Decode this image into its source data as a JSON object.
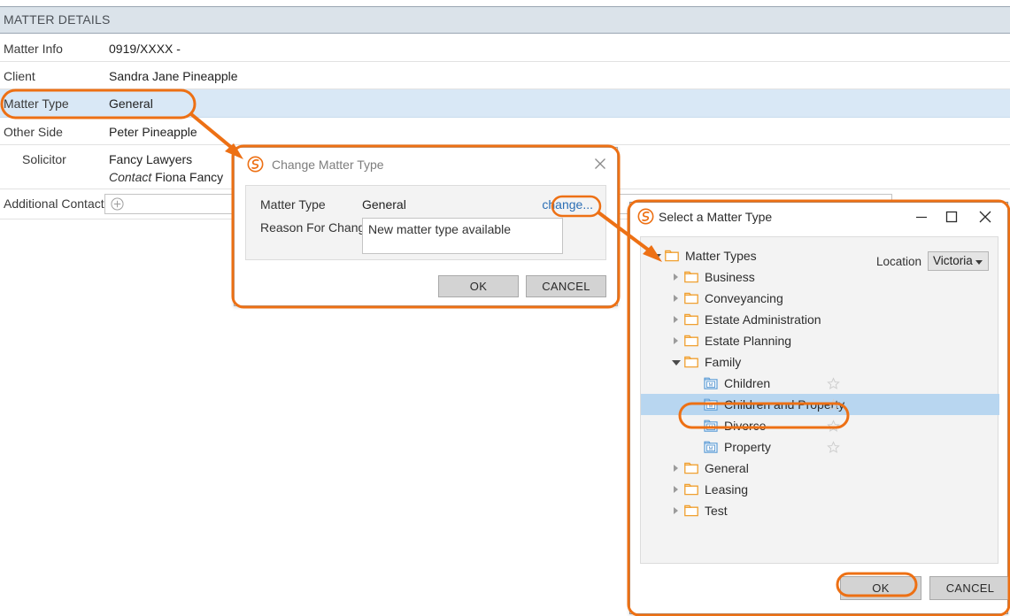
{
  "matter_details": {
    "header": "MATTER DETAILS",
    "rows": [
      {
        "label": "Matter Info",
        "value": "0919/XXXX -",
        "highlight": false
      },
      {
        "label": "Client",
        "value": "Sandra Jane Pineapple",
        "highlight": false
      },
      {
        "label": "Matter Type",
        "value": "General",
        "highlight": true
      },
      {
        "label": "Other Side",
        "value": "Peter Pineapple",
        "highlight": false
      },
      {
        "label": "Solicitor",
        "value": "Fancy Lawyers",
        "value_sub_italic": "Contact",
        "value_sub": "Fiona Fancy",
        "highlight": false
      },
      {
        "label": "Additional Contact",
        "value": "",
        "highlight": false
      }
    ],
    "add_contact_icon": "plus-circle-icon"
  },
  "change_dialog": {
    "title": "Change Matter Type",
    "logo_icon": "app-logo-icon",
    "close_icon": "close-icon",
    "matter_type_label": "Matter Type",
    "matter_type_value": "General",
    "change_link": "change...",
    "reason_label": "Reason For Change",
    "reason_value": "New matter type available",
    "ok_label": "OK",
    "cancel_label": "CANCEL"
  },
  "select_dialog": {
    "title": "Select a Matter Type",
    "logo_icon": "app-logo-icon",
    "minimize_icon": "minimize-icon",
    "maximize_icon": "maximize-icon",
    "close_icon": "close-icon",
    "location_label": "Location",
    "location_value": "Victoria",
    "location_caret_icon": "chevron-down-icon",
    "ok_label": "OK",
    "cancel_label": "CANCEL",
    "tree": [
      {
        "label": "Matter Types",
        "depth": 0,
        "state": "expanded",
        "icon": "folder-icon",
        "star": false,
        "selected": false
      },
      {
        "label": "Business",
        "depth": 1,
        "state": "collapsed",
        "icon": "folder-icon",
        "star": false,
        "selected": false
      },
      {
        "label": "Conveyancing",
        "depth": 1,
        "state": "collapsed",
        "icon": "folder-icon",
        "star": false,
        "selected": false
      },
      {
        "label": "Estate Administration",
        "depth": 1,
        "state": "collapsed",
        "icon": "folder-icon",
        "star": false,
        "selected": false
      },
      {
        "label": "Estate Planning",
        "depth": 1,
        "state": "collapsed",
        "icon": "folder-icon",
        "star": false,
        "selected": false
      },
      {
        "label": "Family",
        "depth": 1,
        "state": "expanded",
        "icon": "folder-icon",
        "star": false,
        "selected": false
      },
      {
        "label": "Children",
        "depth": 2,
        "state": "none",
        "icon": "matter-type-icon",
        "star": true,
        "selected": false
      },
      {
        "label": "Children and Property",
        "depth": 2,
        "state": "none",
        "icon": "matter-type-icon",
        "star": true,
        "selected": true
      },
      {
        "label": "Divorce",
        "depth": 2,
        "state": "none",
        "icon": "matter-type-icon",
        "star": true,
        "selected": false
      },
      {
        "label": "Property",
        "depth": 2,
        "state": "none",
        "icon": "matter-type-icon",
        "star": true,
        "selected": false
      },
      {
        "label": "General",
        "depth": 1,
        "state": "collapsed",
        "icon": "folder-icon",
        "star": false,
        "selected": false
      },
      {
        "label": "Leasing",
        "depth": 1,
        "state": "collapsed",
        "icon": "folder-icon",
        "star": false,
        "selected": false
      },
      {
        "label": "Test",
        "depth": 1,
        "state": "collapsed",
        "icon": "folder-icon",
        "star": false,
        "selected": false
      }
    ]
  },
  "annotations": {
    "accent_color": "#ed7014",
    "callouts": [
      "matter-type-row-highlight",
      "change-matter-type-dialog-highlight",
      "change-link-highlight",
      "select-matter-type-window-highlight",
      "children-and-property-highlight",
      "select-ok-button-highlight"
    ],
    "arrows": [
      "arrow-matter-type-to-change-dialog",
      "arrow-change-link-to-select-window"
    ]
  },
  "colors": {
    "panel_header_bg": "#dbe3ea",
    "row_highlight_bg": "#d9e8f6",
    "tree_selection_bg": "#b8d6f0",
    "link_blue": "#2c6fb5",
    "folder_orange": "#f0a030",
    "matter_icon_blue": "#5b9bd5",
    "accent_orange": "#ed7014"
  }
}
